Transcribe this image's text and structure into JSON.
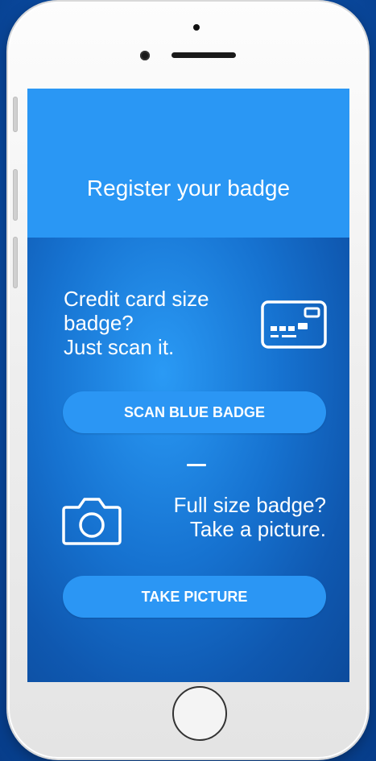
{
  "header": {
    "title": "Register your badge"
  },
  "scan_section": {
    "lines": [
      "Credit card size",
      "badge?",
      "Just scan it."
    ],
    "icon": "credit-card-icon",
    "button_label": "SCAN BLUE BADGE"
  },
  "picture_section": {
    "lines": [
      "Full size badge?",
      "Take a picture."
    ],
    "icon": "camera-icon",
    "button_label": "TAKE PICTURE"
  },
  "colors": {
    "header_blue": "#2a97f4",
    "button_blue": "#2b96f4",
    "background_blue": "#0b4fa8",
    "text": "#ffffff"
  }
}
